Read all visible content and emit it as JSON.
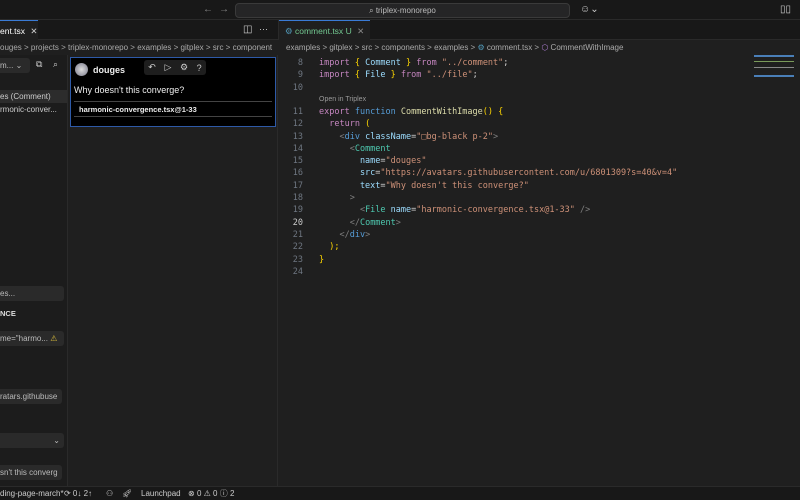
{
  "titlebar": {
    "search": "⌕ triplex-monorepo",
    "back": "←",
    "forward": "→",
    "copilot": "☺⌄"
  },
  "left_tab": {
    "label": "ent.tsx",
    "close": "✕",
    "split": "◫",
    "more": "···"
  },
  "left_breadcrumb": "ouges > projects > triplex-monorepo > examples > gitplex > src > component",
  "right_tab": {
    "label": "comment.tsx",
    "status": "U",
    "close": "✕"
  },
  "right_breadcrumb": {
    "path": "examples > gitplex > src > components > examples >",
    "file": "comment.tsx",
    "symbol": "CommentWithImage"
  },
  "sidebar": {
    "select": "m...",
    "items": [
      "es (Comment)",
      "rmonic-conver..."
    ],
    "filter_placeholder": "es...",
    "section": "NCE",
    "fields": [
      "me=\"harmo...",
      "ratars.githubuse",
      "",
      "sn't this converg"
    ]
  },
  "preview": {
    "username": "douges",
    "text": "Why doesn't this converge?",
    "file": "harmonic-convergence.tsx@1-33",
    "toolbar": [
      "↶",
      "▷",
      "⚙",
      "?"
    ]
  },
  "codelens": "Open in Triplex",
  "code": [
    {
      "n": "8",
      "tokens": [
        [
          "import ",
          "k"
        ],
        [
          "{ ",
          "b"
        ],
        [
          "Comment ",
          "v"
        ],
        [
          "} ",
          "b"
        ],
        [
          "from ",
          "k"
        ],
        [
          "\"../comment\"",
          "s"
        ],
        [
          ";",
          "w"
        ]
      ]
    },
    {
      "n": "9",
      "tokens": [
        [
          "import ",
          "k"
        ],
        [
          "{ ",
          "b"
        ],
        [
          "File ",
          "v"
        ],
        [
          "} ",
          "b"
        ],
        [
          "from ",
          "k"
        ],
        [
          "\"../file\"",
          "s"
        ],
        [
          ";",
          "w"
        ]
      ]
    },
    {
      "n": "10",
      "tokens": []
    },
    {
      "n": "11",
      "tokens": [
        [
          "export ",
          "k"
        ],
        [
          "function ",
          "fn"
        ],
        [
          "CommentWithImage",
          "f"
        ],
        [
          "() {",
          "b"
        ]
      ]
    },
    {
      "n": "12",
      "tokens": [
        [
          "  return ",
          "k"
        ],
        [
          "(",
          "b"
        ]
      ]
    },
    {
      "n": "13",
      "tokens": [
        [
          "    <",
          "p"
        ],
        [
          "div ",
          "fn"
        ],
        [
          "className",
          "v"
        ],
        [
          "=",
          "w"
        ],
        [
          "\"□bg-black p-2\"",
          "s"
        ],
        [
          ">",
          "p"
        ]
      ]
    },
    {
      "n": "14",
      "tokens": [
        [
          "      <",
          "p"
        ],
        [
          "Comment",
          "g"
        ]
      ]
    },
    {
      "n": "15",
      "tokens": [
        [
          "        name",
          "v"
        ],
        [
          "=",
          "w"
        ],
        [
          "\"douges\"",
          "s"
        ]
      ]
    },
    {
      "n": "16",
      "tokens": [
        [
          "        src",
          "v"
        ],
        [
          "=",
          "w"
        ],
        [
          "\"https://avatars.githubusercontent.com/u/6801309?s=40&v=4\"",
          "s"
        ]
      ]
    },
    {
      "n": "17",
      "tokens": [
        [
          "        text",
          "v"
        ],
        [
          "=",
          "w"
        ],
        [
          "\"Why doesn't this converge?\"",
          "s"
        ]
      ]
    },
    {
      "n": "18",
      "tokens": [
        [
          "      >",
          "p"
        ]
      ]
    },
    {
      "n": "19",
      "tokens": [
        [
          "        <",
          "p"
        ],
        [
          "File ",
          "g"
        ],
        [
          "name",
          "v"
        ],
        [
          "=",
          "w"
        ],
        [
          "\"harmonic-convergence.tsx@1-33\"",
          "s"
        ],
        [
          " />",
          "p"
        ]
      ]
    },
    {
      "n": "20",
      "tokens": [
        [
          "      </",
          "p"
        ],
        [
          "Comment",
          "g"
        ],
        [
          ">",
          "p"
        ]
      ]
    },
    {
      "n": "21",
      "tokens": [
        [
          "    </",
          "p"
        ],
        [
          "div",
          "fn"
        ],
        [
          ">",
          "p"
        ]
      ]
    },
    {
      "n": "22",
      "tokens": [
        [
          "  ",
          "w"
        ],
        [
          ");",
          "b"
        ]
      ]
    },
    {
      "n": "23",
      "tokens": [
        [
          "}",
          "b"
        ]
      ]
    },
    {
      "n": "24",
      "tokens": []
    }
  ],
  "status": {
    "branch": "ding-page-march*",
    "sync": "⟳ 0↓ 2↑",
    "launchpad": "Launchpad",
    "errors": "0",
    "warnings": "0",
    "info": "2"
  }
}
